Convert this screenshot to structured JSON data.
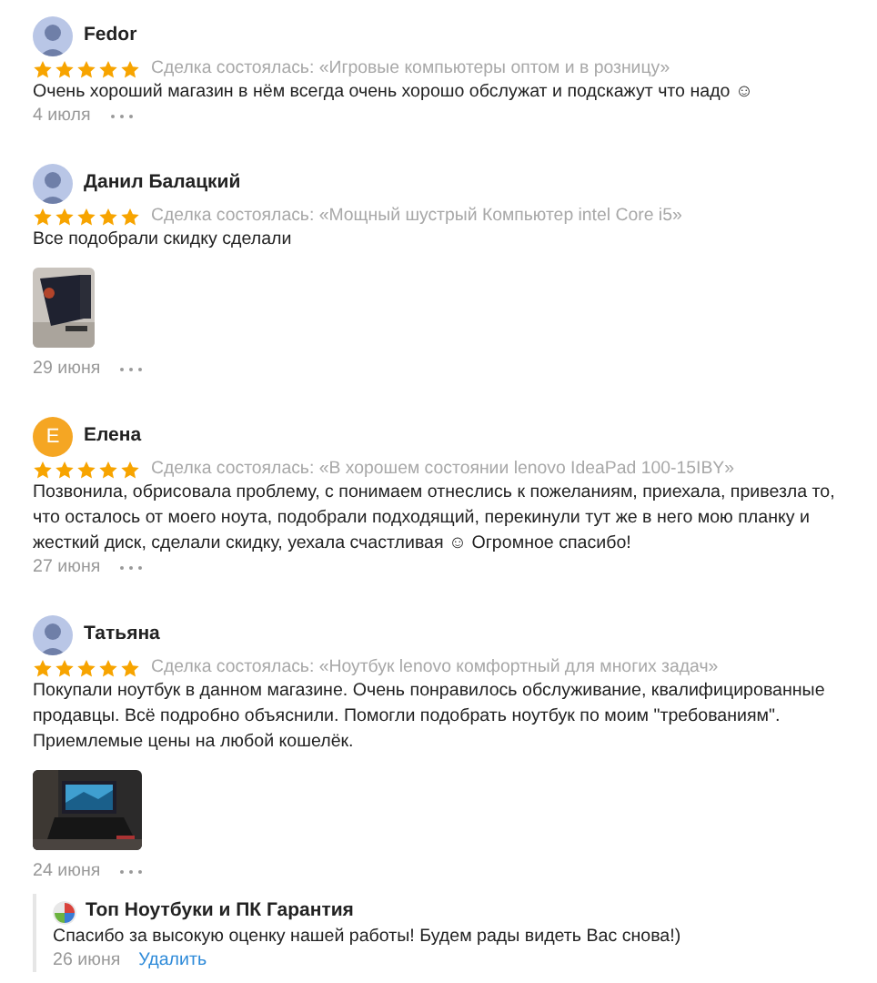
{
  "reviews": [
    {
      "author": "Fedor",
      "stars": 5,
      "deal": "Сделка состоялась: «Игровые компьютеры оптом и в розницу»",
      "body": "Очень хороший магазин в нём всегда очень хорошо обслужат и подскажут что надо ☺",
      "date": "4 июля"
    },
    {
      "author": "Данил Балацкий",
      "stars": 5,
      "deal": "Сделка состоялась: «Мощный шустрый Компьютер intel Core i5»",
      "body": "Все подобрали скидку сделали",
      "date": "29 июня"
    },
    {
      "author": "Елена",
      "avatar": {
        "kind": "letter",
        "letter": "Е",
        "color": "#f5a623"
      },
      "stars": 5,
      "deal": "Сделка состоялась: «В хорошем состоянии lenovo IdeaPad 100-15IBY»",
      "body": "Позвонила, обрисовала проблему, с понимаем отнеслись к пожеланиям, приехала, привезла то, что осталось от моего ноута, подобрали подходящий, перекинули тут же в него мою планку и жесткий диск, сделали скидку, уехала счастливая ☺ Огромное спасибо!",
      "date": "27 июня"
    },
    {
      "author": "Татьяна",
      "stars": 5,
      "deal": "Сделка состоялась: «Ноутбук lenovo комфортный для многих задач»",
      "body": "Покупали ноутбук в данном магазине. Очень понравилось обслуживание, квалифицированные продавцы. Всё подробно объяснили. Помогли подобрать ноутбук по моим \"требованиям\". Приемлемые цены на любой кошелёк.",
      "date": "24 июня",
      "reply": {
        "author": "Топ Ноутбуки и ПК Гарантия",
        "text": "Спасибо за высокую оценку нашей работы! Будем рады видеть Вас снова!)",
        "date": "26 июня",
        "action": "Удалить"
      }
    }
  ]
}
